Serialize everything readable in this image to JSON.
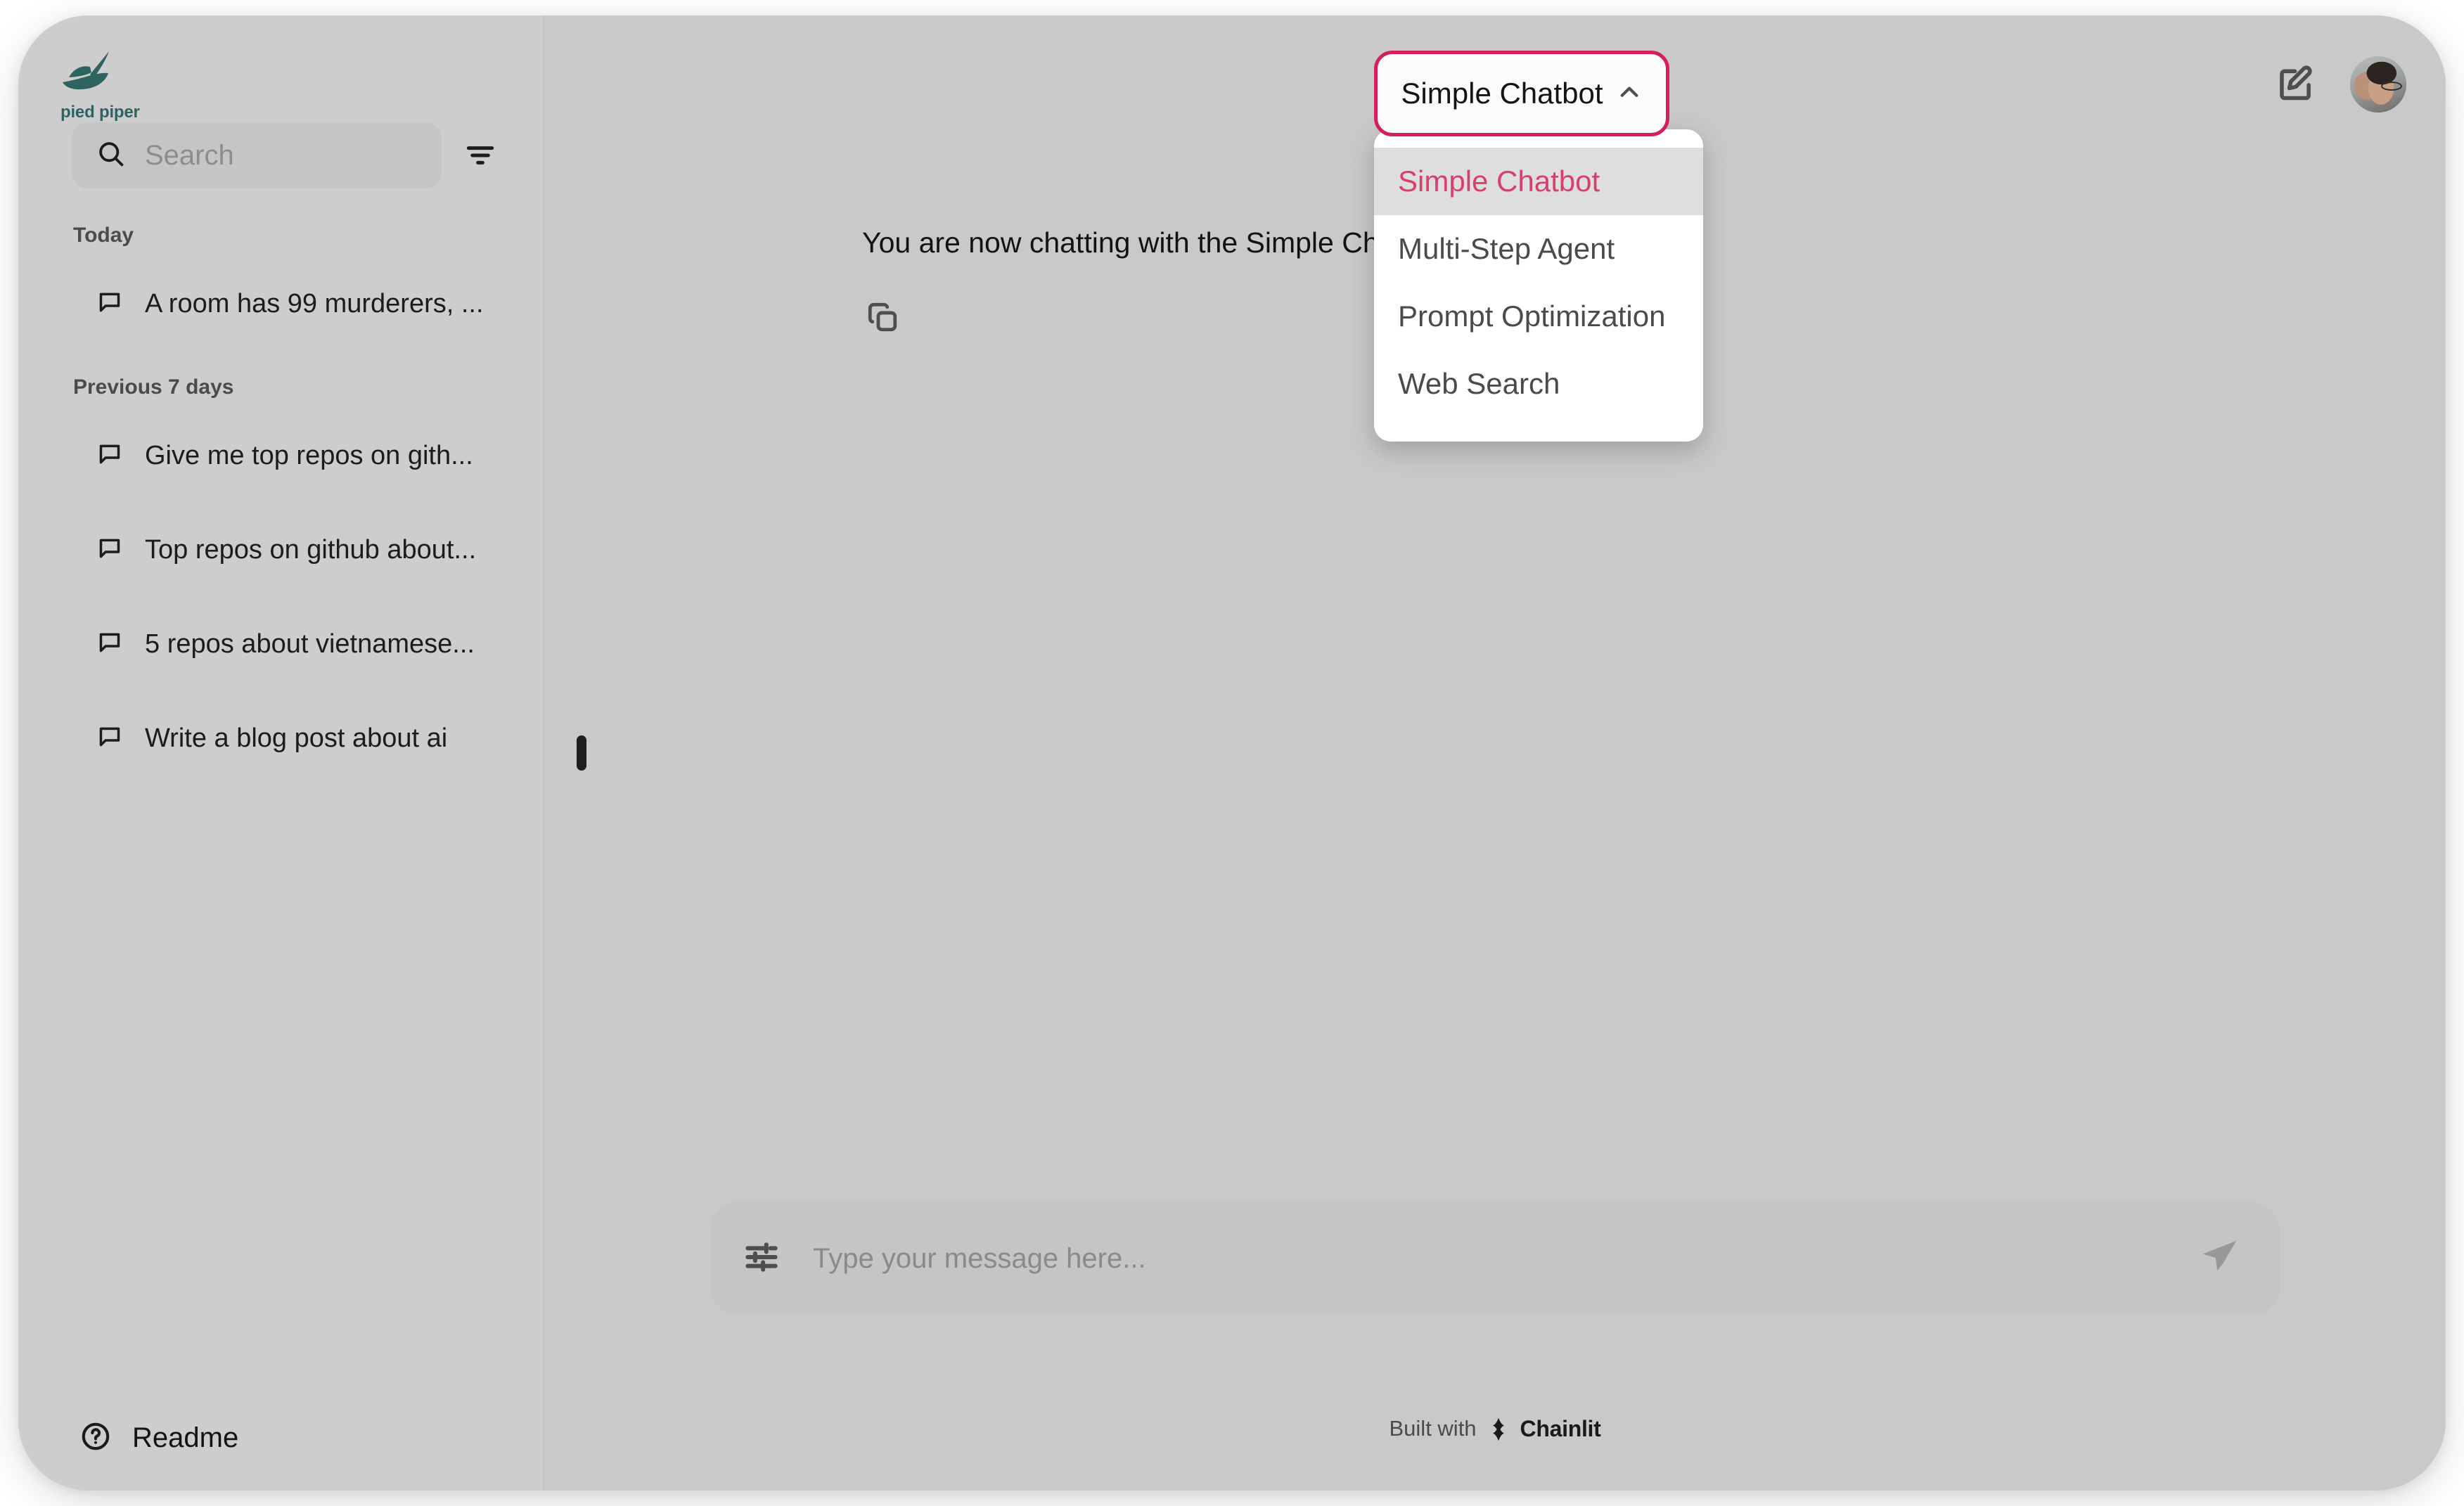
{
  "brand": {
    "logo_name": "pied-piper-logo",
    "logo_text": "pied piper",
    "logo_color": "#2e6460"
  },
  "theme": {
    "accent": "#d41e5e",
    "accent_text": "#d93f6c",
    "window_bg": "#cbcbcb",
    "sidebar_bg": "#cdcdcd",
    "main_bg": "#c9c9c9",
    "menu_bg": "#ffffff",
    "menu_active_bg": "#dedede"
  },
  "sidebar": {
    "search": {
      "placeholder": "Search",
      "icon": "search-icon"
    },
    "filter_icon": "filter-icon",
    "groups": [
      {
        "label": "Today",
        "items": [
          {
            "icon": "chat-bubble-icon",
            "title": "A room has 99 murderers, ..."
          }
        ]
      },
      {
        "label": "Previous 7 days",
        "items": [
          {
            "icon": "chat-bubble-icon",
            "title": "Give me top repos on gith..."
          },
          {
            "icon": "chat-bubble-icon",
            "title": "Top repos on github about..."
          },
          {
            "icon": "chat-bubble-icon",
            "title": "5 repos about vietnamese..."
          },
          {
            "icon": "chat-bubble-icon",
            "title": "Write a blog post about ai"
          }
        ]
      }
    ],
    "readme": {
      "icon": "help-circle-icon",
      "label": "Readme"
    }
  },
  "topbar": {
    "new_chat_icon": "edit-square-icon",
    "avatar_icon": "user-avatar"
  },
  "profile_selector": {
    "selected": "Simple Chatbot",
    "chevron_icon": "chevron-up-icon",
    "expanded": true,
    "options": [
      {
        "label": "Simple Chatbot",
        "selected": true
      },
      {
        "label": "Multi-Step Agent",
        "selected": false
      },
      {
        "label": "Prompt Optimization",
        "selected": false
      },
      {
        "label": "Web Search",
        "selected": false
      }
    ]
  },
  "chat": {
    "system_message": "You are now chatting with the Simple Chatbot chat profile now.",
    "copy_icon": "copy-icon"
  },
  "composer": {
    "settings_icon": "sliders-icon",
    "placeholder": "Type your message here...",
    "send_icon": "send-plane-icon"
  },
  "footer": {
    "built_with": "Built with",
    "brand": "Chainlit",
    "logo_icon": "chainlit-logo-icon"
  }
}
